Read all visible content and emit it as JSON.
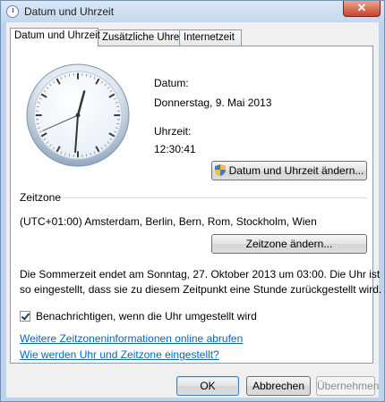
{
  "window": {
    "title": "Datum und Uhrzeit",
    "close_glyph": "✕"
  },
  "tabs": [
    {
      "label": "Datum und Uhrzeit",
      "active": true
    },
    {
      "label": "Zusätzliche Uhren",
      "active": false
    },
    {
      "label": "Internetzeit",
      "active": false
    }
  ],
  "datetime": {
    "date_label": "Datum:",
    "date_value": "Donnerstag, 9. Mai 2013",
    "time_label": "Uhrzeit:",
    "time_value": "12:30:41",
    "change_button": "Datum und Uhrzeit ändern..."
  },
  "timezone": {
    "section_label": "Zeitzone",
    "value": "(UTC+01:00) Amsterdam, Berlin, Bern, Rom, Stockholm, Wien",
    "change_button": "Zeitzone ändern..."
  },
  "dst_info": {
    "line1": "Die Sommerzeit endet am Sonntag, 27. Oktober 2013 um 03:00. Die Uhr ist",
    "line2": "so eingestellt, dass sie zu diesem Zeitpunkt eine Stunde zurückgestellt wird."
  },
  "notify": {
    "label": "Benachrichtigen, wenn die Uhr umgestellt wird",
    "checked": true
  },
  "links": {
    "more_info": "Weitere Zeitzoneninformationen online abrufen",
    "how_set": "Wie werden Uhr und Zeitzone eingestellt?"
  },
  "footer": {
    "ok": "OK",
    "cancel": "Abbrechen",
    "apply": "Übernehmen"
  },
  "clock": {
    "hours": 12,
    "minutes": 30,
    "seconds": 41
  },
  "icons": {
    "title": "clock-icon",
    "uac": "shield-icon"
  }
}
